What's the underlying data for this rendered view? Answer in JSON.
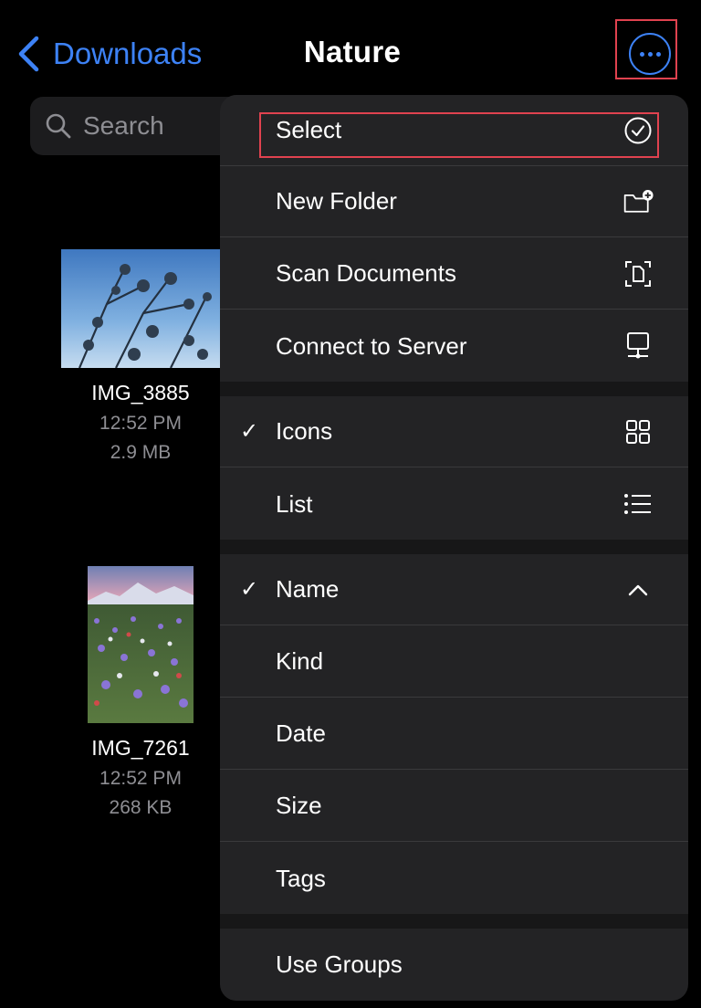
{
  "nav": {
    "back_label": "Downloads",
    "title": "Nature"
  },
  "search": {
    "placeholder": "Search"
  },
  "files": [
    {
      "name": "IMG_3885",
      "time": "12:52 PM",
      "size": "2.9 MB"
    },
    {
      "name": "IMG_7261",
      "time": "12:52 PM",
      "size": "268 KB"
    }
  ],
  "menu": {
    "section1": [
      {
        "label": "Select",
        "icon": "checkmark-circle-icon"
      },
      {
        "label": "New Folder",
        "icon": "folder-plus-icon"
      },
      {
        "label": "Scan Documents",
        "icon": "doc-scanner-icon"
      },
      {
        "label": "Connect to Server",
        "icon": "desktop-server-icon"
      }
    ],
    "section2": [
      {
        "label": "Icons",
        "checked": "✓",
        "icon": "grid-icon"
      },
      {
        "label": "List",
        "icon": "list-icon"
      }
    ],
    "section3": [
      {
        "label": "Name",
        "checked": "✓",
        "icon": "chevron-up-icon"
      },
      {
        "label": "Kind"
      },
      {
        "label": "Date"
      },
      {
        "label": "Size"
      },
      {
        "label": "Tags"
      }
    ],
    "section4": [
      {
        "label": "Use Groups"
      }
    ]
  },
  "colors": {
    "accent": "#3d82f6",
    "highlight": "#e0424f",
    "menu_bg": "#232325"
  }
}
